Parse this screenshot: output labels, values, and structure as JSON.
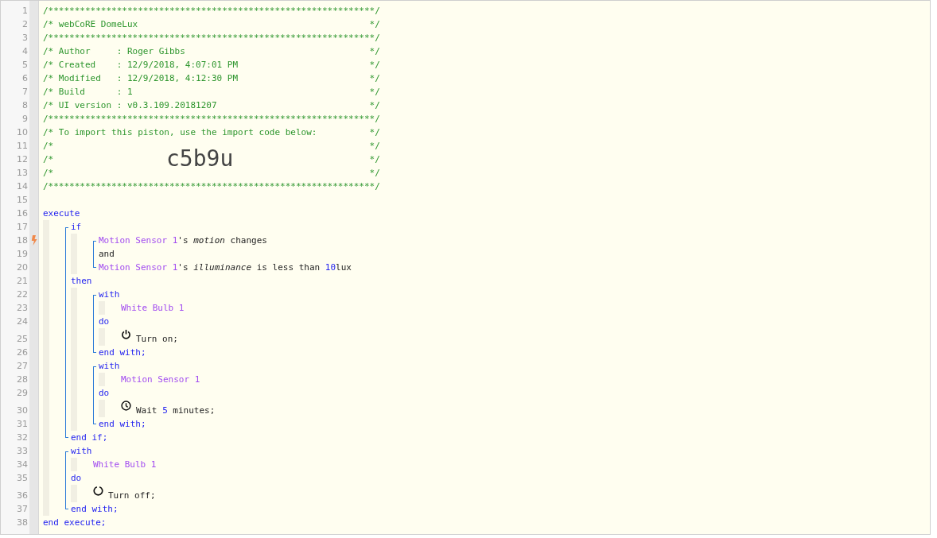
{
  "code": [
    {
      "kind": "line",
      "number": "1",
      "trigger": false,
      "tokens": [
        {
          "kind": "comment",
          "text": "/**************************************************************/"
        }
      ]
    },
    {
      "kind": "line",
      "number": "2",
      "trigger": false,
      "tokens": [
        {
          "kind": "comment",
          "text": "/* webCoRE DomeLux"
        },
        {
          "kind": "comment_end",
          "text": "*/"
        }
      ]
    },
    {
      "kind": "line",
      "number": "3",
      "trigger": false,
      "tokens": [
        {
          "kind": "comment",
          "text": "/**************************************************************/"
        }
      ]
    },
    {
      "kind": "line",
      "number": "4",
      "trigger": false,
      "tokens": [
        {
          "kind": "comment",
          "text": "/* Author     : Roger Gibbs"
        },
        {
          "kind": "comment_end",
          "text": "*/"
        }
      ]
    },
    {
      "kind": "line",
      "number": "5",
      "trigger": false,
      "tokens": [
        {
          "kind": "comment",
          "text": "/* Created    : 12/9/2018, 4:07:01 PM"
        },
        {
          "kind": "comment_end",
          "text": "*/"
        }
      ]
    },
    {
      "kind": "line",
      "number": "6",
      "trigger": false,
      "tokens": [
        {
          "kind": "comment",
          "text": "/* Modified   : 12/9/2018, 4:12:30 PM"
        },
        {
          "kind": "comment_end",
          "text": "*/"
        }
      ]
    },
    {
      "kind": "line",
      "number": "7",
      "trigger": false,
      "tokens": [
        {
          "kind": "comment",
          "text": "/* Build      : 1"
        },
        {
          "kind": "comment_end",
          "text": "*/"
        }
      ]
    },
    {
      "kind": "line",
      "number": "8",
      "trigger": false,
      "tokens": [
        {
          "kind": "comment",
          "text": "/* UI version : v0.3.109.20181207"
        },
        {
          "kind": "comment_end",
          "text": "*/"
        }
      ]
    },
    {
      "kind": "line",
      "number": "9",
      "trigger": false,
      "tokens": [
        {
          "kind": "comment",
          "text": "/**************************************************************/"
        }
      ]
    },
    {
      "kind": "line",
      "number": "10",
      "trigger": false,
      "tokens": [
        {
          "kind": "comment",
          "text": "/* To import this piston, use the import code below:"
        },
        {
          "kind": "comment_end",
          "text": "*/"
        }
      ]
    },
    {
      "kind": "line",
      "number": "11",
      "trigger": false,
      "tokens": [
        {
          "kind": "comment",
          "text": "/*"
        },
        {
          "kind": "comment_end",
          "text": "*/"
        }
      ]
    },
    {
      "kind": "line",
      "number": "12",
      "trigger": false,
      "tokens": [
        {
          "kind": "comment",
          "text": "/*"
        },
        {
          "kind": "import_code",
          "text": "c5b9u"
        },
        {
          "kind": "comment_end",
          "text": "*/"
        }
      ]
    },
    {
      "kind": "line",
      "number": "13",
      "trigger": false,
      "tokens": [
        {
          "kind": "comment",
          "text": "/*"
        },
        {
          "kind": "comment_end",
          "text": "*/"
        }
      ]
    },
    {
      "kind": "line",
      "number": "14",
      "trigger": false,
      "tokens": [
        {
          "kind": "comment",
          "text": "/**************************************************************/"
        }
      ]
    },
    {
      "kind": "line",
      "number": "15",
      "trigger": false
    },
    {
      "kind": "line",
      "number": "16",
      "trigger": false,
      "tokens": [
        {
          "kind": "keyword",
          "text": "execute"
        }
      ]
    },
    {
      "kind": "group",
      "children": [
        {
          "kind": "bracket",
          "children": [
            {
              "kind": "line",
              "number": "17",
              "trigger": false,
              "tokens": [
                {
                  "kind": "keyword",
                  "text": "if"
                }
              ]
            },
            {
              "kind": "group",
              "children": [
                {
                  "kind": "bracket",
                  "children": [
                    {
                      "kind": "line",
                      "number": "18",
                      "trigger": true,
                      "tokens": [
                        {
                          "kind": "device",
                          "text": "Motion Sensor 1"
                        },
                        {
                          "kind": "text",
                          "text": "'s "
                        },
                        {
                          "kind": "attribute",
                          "text": "motion"
                        },
                        {
                          "kind": "text",
                          "text": " changes"
                        }
                      ]
                    },
                    {
                      "kind": "line",
                      "number": "19",
                      "trigger": false,
                      "tokens": [
                        {
                          "kind": "text",
                          "text": "and"
                        }
                      ]
                    },
                    {
                      "kind": "line",
                      "number": "20",
                      "trigger": false,
                      "tokens": [
                        {
                          "kind": "device",
                          "text": "Motion Sensor 1"
                        },
                        {
                          "kind": "text",
                          "text": "'s "
                        },
                        {
                          "kind": "attribute",
                          "text": "illuminance"
                        },
                        {
                          "kind": "text",
                          "text": " is less than "
                        },
                        {
                          "kind": "number",
                          "text": "10"
                        },
                        {
                          "kind": "text",
                          "text": "lux"
                        }
                      ]
                    }
                  ]
                }
              ]
            },
            {
              "kind": "line",
              "number": "21",
              "trigger": false,
              "tokens": [
                {
                  "kind": "keyword",
                  "text": "then"
                }
              ]
            },
            {
              "kind": "group",
              "children": [
                {
                  "kind": "bracket",
                  "children": [
                    {
                      "kind": "line",
                      "number": "22",
                      "trigger": false,
                      "tokens": [
                        {
                          "kind": "keyword",
                          "text": "with"
                        }
                      ]
                    },
                    {
                      "kind": "group",
                      "children": [
                        {
                          "kind": "line",
                          "number": "23",
                          "trigger": false,
                          "tokens": [
                            {
                              "kind": "device",
                              "text": "White Bulb 1"
                            }
                          ]
                        }
                      ]
                    },
                    {
                      "kind": "line",
                      "number": "24",
                      "trigger": false,
                      "tokens": [
                        {
                          "kind": "keyword",
                          "text": "do"
                        }
                      ]
                    },
                    {
                      "kind": "group",
                      "children": [
                        {
                          "kind": "switch_on",
                          "number": "25",
                          "trigger": false,
                          "tokens": [
                            {
                              "kind": "text",
                              "text": "Turn on;"
                            }
                          ]
                        }
                      ]
                    },
                    {
                      "kind": "line",
                      "number": "26",
                      "trigger": false,
                      "tokens": [
                        {
                          "kind": "keyword",
                          "text": "end with;"
                        }
                      ]
                    }
                  ]
                },
                {
                  "kind": "bracket",
                  "children": [
                    {
                      "kind": "line",
                      "number": "27",
                      "trigger": false,
                      "tokens": [
                        {
                          "kind": "keyword",
                          "text": "with"
                        }
                      ]
                    },
                    {
                      "kind": "group",
                      "children": [
                        {
                          "kind": "line",
                          "number": "28",
                          "trigger": false,
                          "tokens": [
                            {
                              "kind": "device",
                              "text": "Motion Sensor 1"
                            }
                          ]
                        }
                      ]
                    },
                    {
                      "kind": "line",
                      "number": "29",
                      "trigger": false,
                      "tokens": [
                        {
                          "kind": "keyword",
                          "text": "do"
                        }
                      ]
                    },
                    {
                      "kind": "group",
                      "children": [
                        {
                          "kind": "wait",
                          "number": "30",
                          "trigger": false,
                          "tokens": [
                            {
                              "kind": "text",
                              "text": "Wait "
                            },
                            {
                              "kind": "number",
                              "text": "5"
                            },
                            {
                              "kind": "text",
                              "text": " minutes;"
                            }
                          ]
                        }
                      ]
                    },
                    {
                      "kind": "line",
                      "number": "31",
                      "trigger": false,
                      "tokens": [
                        {
                          "kind": "keyword",
                          "text": "end with;"
                        }
                      ]
                    }
                  ]
                }
              ]
            },
            {
              "kind": "line",
              "number": "32",
              "trigger": false,
              "tokens": [
                {
                  "kind": "keyword",
                  "text": "end if;"
                }
              ]
            }
          ]
        },
        {
          "kind": "bracket",
          "children": [
            {
              "kind": "line",
              "number": "33",
              "trigger": false,
              "tokens": [
                {
                  "kind": "keyword",
                  "text": "with"
                }
              ]
            },
            {
              "kind": "group",
              "children": [
                {
                  "kind": "line",
                  "number": "34",
                  "trigger": false,
                  "tokens": [
                    {
                      "kind": "device",
                      "text": "White Bulb 1"
                    }
                  ]
                }
              ]
            },
            {
              "kind": "line",
              "number": "35",
              "trigger": false,
              "tokens": [
                {
                  "kind": "keyword",
                  "text": "do"
                }
              ]
            },
            {
              "kind": "group",
              "children": [
                {
                  "kind": "switch_off",
                  "number": "36",
                  "trigger": false,
                  "tokens": [
                    {
                      "kind": "text",
                      "text": "Turn off;"
                    }
                  ]
                }
              ]
            },
            {
              "kind": "line",
              "number": "37",
              "trigger": false,
              "tokens": [
                {
                  "kind": "keyword",
                  "text": "end with;"
                }
              ]
            }
          ]
        }
      ]
    },
    {
      "kind": "line",
      "number": "38",
      "trigger": false,
      "tokens": [
        {
          "kind": "keyword",
          "text": "end execute;"
        }
      ]
    }
  ]
}
